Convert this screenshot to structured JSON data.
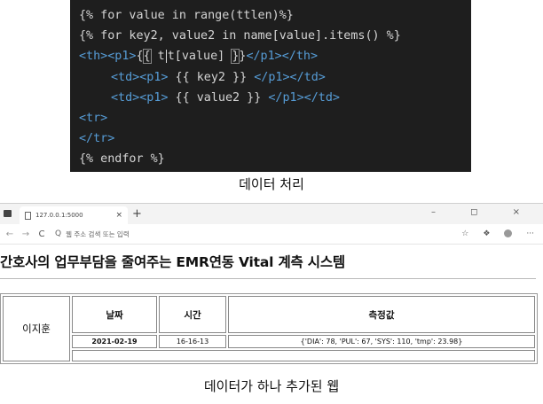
{
  "code": {
    "line1": "{% for value in range(ttlen)%}",
    "line2": "{% for key2, value2 in name[value].items() %}",
    "line3_tag_open": "<th><p1>",
    "line3_b1": "{",
    "line3_b2": "{",
    "line3_var_a": " t",
    "line3_var_b": "t[value] ",
    "line3_b3": "}",
    "line3_b4": "}",
    "line3_tag_close": "</p1></th>",
    "line4_open": "<td><p1>",
    "line4_var": " {{ key2 }} ",
    "line4_close": "</p1></td>",
    "line5_open": "<td><p1>",
    "line5_var": " {{ value2 }} ",
    "line5_close": "</p1></td>",
    "line6": "<tr>",
    "line7": "</tr>",
    "line8": "{% endfor %}"
  },
  "caption_top": "데이터 처리",
  "caption_bottom": "데이터가 하나 추가된 웹",
  "browser": {
    "tab_title": "127.0.0.1:5000",
    "tab_close": "×",
    "new_tab": "+",
    "window_controls": "– ◻ ×",
    "back": "←",
    "forward": "→",
    "reload": "C",
    "search_icon": "Q",
    "url_placeholder": "웹 주소 검색 또는 입력",
    "tool1": "☆",
    "tool2": "❖",
    "more": "···"
  },
  "page": {
    "heading": "간호사의 업무부담을 줄여주는 EMR연동 Vital 계측 시스템",
    "table": {
      "name": "이지훈",
      "headers": [
        "날짜",
        "시간",
        "측정값"
      ],
      "row": [
        "2021-02-19",
        "16-16-13",
        "{'DIA': 78, 'PUL': 67, 'SYS': 110, 'tmp': 23.98}"
      ]
    }
  }
}
